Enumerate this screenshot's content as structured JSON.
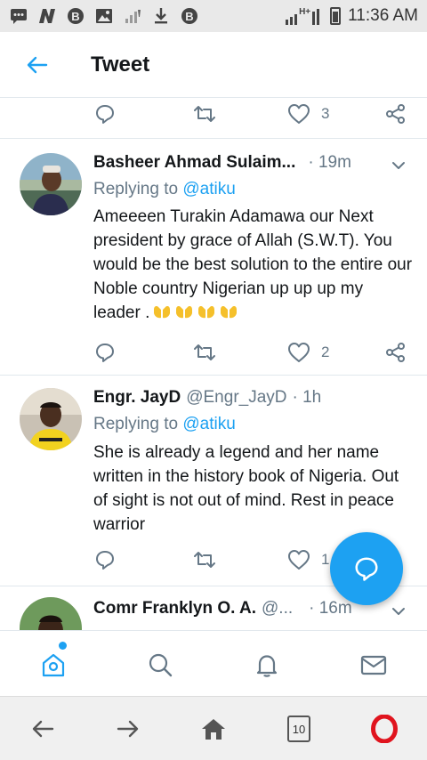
{
  "status_bar": {
    "network_label": "H+",
    "time": "11:36 AM",
    "left_icons": [
      "message-icon",
      "n-icon",
      "b-icon",
      "image-icon",
      "sim-signal-icon",
      "download-icon",
      "b-icon"
    ],
    "right_icons": [
      "signal-icon",
      "battery-icon"
    ]
  },
  "header": {
    "title": "Tweet"
  },
  "top_actions": {
    "like_count": "3"
  },
  "tweets": [
    {
      "name": "Basheer Ahmad Sulaim...",
      "handle": "",
      "time": "· 19m",
      "reply_prefix": "Replying to ",
      "reply_to": "@atiku",
      "text": "Ameeeen Turakin Adamawa our Next president by grace of Allah (S.W.T). You would be the best solution to the entire our Noble country Nigerian up up up my leader .",
      "like_count": "2"
    },
    {
      "name": "Engr. JayD",
      "handle": "@Engr_JayD",
      "time": "· 1h",
      "reply_prefix": "Replying to ",
      "reply_to": "@atiku",
      "text": "She is already a legend and her name written in the history book of Nigeria. Out of sight is not out of mind. Rest in peace warrior",
      "like_count": "1"
    },
    {
      "name": "Comr Franklyn O. A.",
      "handle": "@...",
      "time": "· 16m"
    }
  ],
  "tabbar": {
    "items": [
      "home-icon",
      "search-icon",
      "notifications-icon",
      "messages-icon"
    ]
  },
  "browser": {
    "tab_count": "10"
  },
  "colors": {
    "accent": "#1da1f2",
    "muted": "#657786",
    "text": "#14171a",
    "opera_red": "#e0141e"
  }
}
